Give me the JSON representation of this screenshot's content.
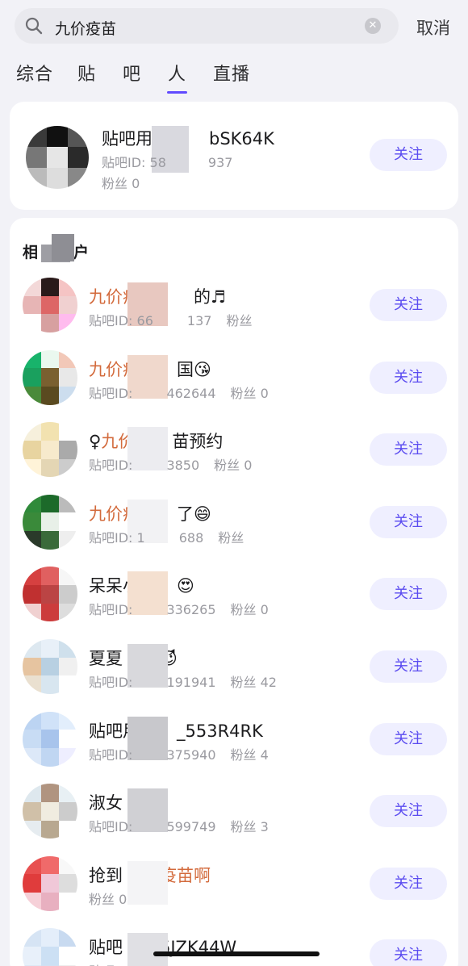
{
  "search": {
    "query": "九价疫苗",
    "cancel_label": "取消"
  },
  "tabs": [
    {
      "label": "综合",
      "active": false
    },
    {
      "label": "贴",
      "active": false
    },
    {
      "label": "吧",
      "active": false
    },
    {
      "label": "人",
      "active": true
    },
    {
      "label": "直播",
      "active": false
    }
  ],
  "top_user": {
    "name_prefix": "贴吧用",
    "name_suffix": "bSK64K",
    "id_label": "贴吧ID: 58",
    "id_suffix": "937",
    "fans": "粉丝 0",
    "follow_label": "关注"
  },
  "related_section": {
    "title_start": "相",
    "title_end": "户"
  },
  "users": [
    {
      "name_parts": [
        {
          "t": "九价疫苗",
          "hl": true
        },
        {
          "t": "",
          "hl": false
        }
      ],
      "name_tail": "的♬",
      "id_text": "贴吧ID: 66",
      "id_tail": "137",
      "fans": "粉丝",
      "follow_label": "关注"
    },
    {
      "name_parts": [
        {
          "t": "九价疫",
          "hl": true
        }
      ],
      "name_tail": "国😘",
      "id_text": "贴吧ID:",
      "id_tail": "462644",
      "fans": "粉丝 0",
      "follow_label": "关注"
    },
    {
      "name_parts": [
        {
          "t": "♀",
          "hl": false
        },
        {
          "t": "九价",
          "hl": true
        }
      ],
      "name_tail": "苗预约",
      "id_text": "贴吧ID:",
      "id_tail": "3850",
      "fans": "粉丝 0",
      "follow_label": "关注"
    },
    {
      "name_parts": [
        {
          "t": "九价疫",
          "hl": true
        }
      ],
      "name_tail": "了😄",
      "id_text": "贴吧ID: 1",
      "id_tail": "688",
      "fans": "粉丝",
      "follow_label": "关注"
    },
    {
      "name_parts": [
        {
          "t": "呆呆小",
          "hl": false
        }
      ],
      "name_tail": "😍",
      "id_text": "贴吧ID:",
      "id_tail": "336265",
      "fans": "粉丝 0",
      "follow_label": "关注"
    },
    {
      "name_parts": [
        {
          "t": "夏夏",
          "hl": false
        }
      ],
      "name_tail": "😈",
      "id_text": "贴吧ID:",
      "id_tail": "191941",
      "fans": "粉丝 42",
      "follow_label": "关注"
    },
    {
      "name_parts": [
        {
          "t": "贴吧用",
          "hl": false
        }
      ],
      "name_tail": "_553R4RK",
      "id_text": "贴吧ID:",
      "id_tail": "375940",
      "fans": "粉丝 4",
      "follow_label": "关注"
    },
    {
      "name_parts": [
        {
          "t": "淑女",
          "hl": false
        }
      ],
      "name_tail": "",
      "id_text": "贴吧ID:",
      "id_tail": "599749",
      "fans": "粉丝 3",
      "follow_label": "关注"
    },
    {
      "name_parts": [
        {
          "t": "抢到",
          "hl": false
        }
      ],
      "name_tail": "疫苗啊",
      "id_text": "粉丝 0",
      "id_tail": "",
      "fans": "",
      "follow_label": "关注"
    },
    {
      "name_parts": [
        {
          "t": "贴吧",
          "hl": false
        }
      ],
      "name_tail": "5JZK44W",
      "id_text": "贴吧ID:",
      "id_tail": "",
      "fans": "",
      "follow_label": "关注"
    }
  ],
  "colors": {
    "accent": "#614bff",
    "highlight": "#d36b3d",
    "follow_bg": "#efefff"
  }
}
